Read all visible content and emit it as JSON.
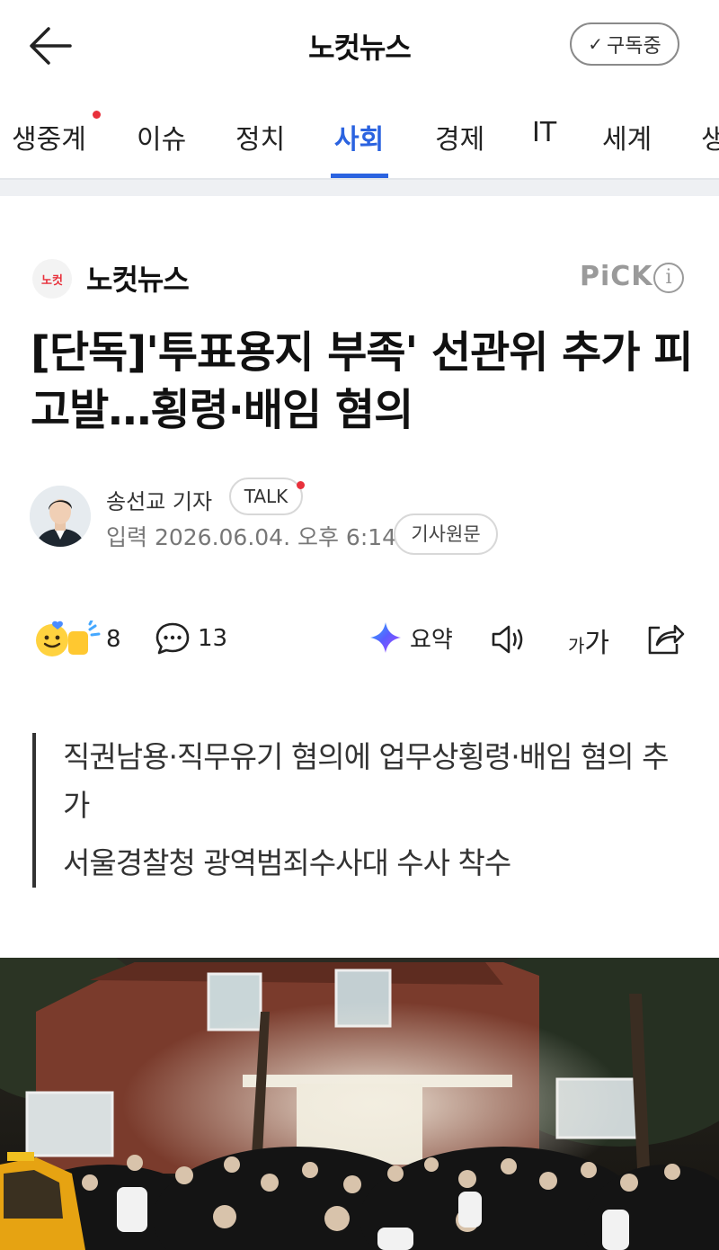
{
  "header": {
    "title": "노컷뉴스",
    "subscribe_label": "구독중"
  },
  "tabs": [
    {
      "label": "생중계",
      "live": true
    },
    {
      "label": "이슈"
    },
    {
      "label": "정치"
    },
    {
      "label": "사회",
      "active": true
    },
    {
      "label": "경제"
    },
    {
      "label": "IT"
    },
    {
      "label": "세계"
    },
    {
      "label": "생"
    }
  ],
  "publisher": {
    "logo_text": "노컷",
    "name": "노컷뉴스",
    "pick_label": "PiCK",
    "info_label": "i"
  },
  "article": {
    "title": "[단독]'투표용지 부족' 선관위 추가 피고발…횡령·배임 혐의",
    "reporter": "송선교 기자",
    "talk_label": "TALK",
    "date": "입력 2026.06.04. 오후 6:14",
    "original_label": "기사원문",
    "summary": [
      "직권남용·직무유기 혐의에 업무상횡령·배임 혐의 추가",
      "서울경찰청 광역범죄수사대 수사 착수"
    ]
  },
  "actions": {
    "reaction_count": "8",
    "comment_count": "13",
    "summary_label": "요약",
    "font_label_small": "가",
    "font_label_large": "가"
  },
  "colors": {
    "accent": "#2b63e0",
    "live_dot": "#e8303b"
  }
}
